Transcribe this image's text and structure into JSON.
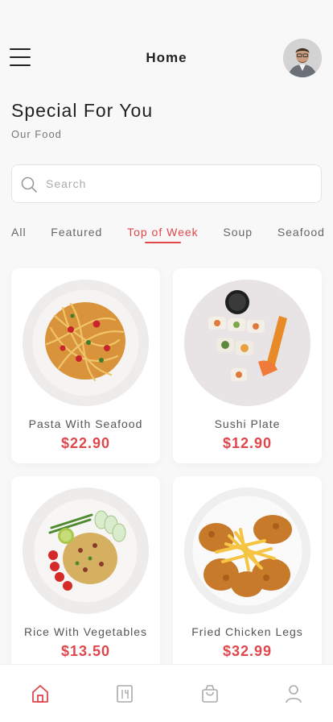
{
  "header": {
    "title": "Home",
    "menu_icon": "hamburger-menu-icon",
    "avatar_icon": "user-avatar"
  },
  "section": {
    "title": "Special For You",
    "subtitle": "Our Food"
  },
  "search": {
    "placeholder": "Search",
    "value": "",
    "icon": "search-icon"
  },
  "tabs": [
    {
      "label": "All",
      "active": false
    },
    {
      "label": "Featured",
      "active": false
    },
    {
      "label": "Top of Week",
      "active": true
    },
    {
      "label": "Soup",
      "active": false
    },
    {
      "label": "Seafood",
      "active": false
    }
  ],
  "products": [
    {
      "name": "Pasta With Seafood",
      "price": "$22.90"
    },
    {
      "name": "Sushi Plate",
      "price": "$12.90"
    },
    {
      "name": "Rice With Vegetables",
      "price": "$13.50"
    },
    {
      "name": "Fried Chicken Legs",
      "price": "$32.99"
    }
  ],
  "bottom_nav": [
    {
      "icon": "home-icon",
      "active": true
    },
    {
      "icon": "menu-book-icon",
      "active": false
    },
    {
      "icon": "cart-bag-icon",
      "active": false
    },
    {
      "icon": "profile-icon",
      "active": false
    }
  ],
  "colors": {
    "accent": "#e0474c",
    "background": "#f8f8f8",
    "card": "#ffffff",
    "text": "#222222",
    "muted": "#777777"
  }
}
